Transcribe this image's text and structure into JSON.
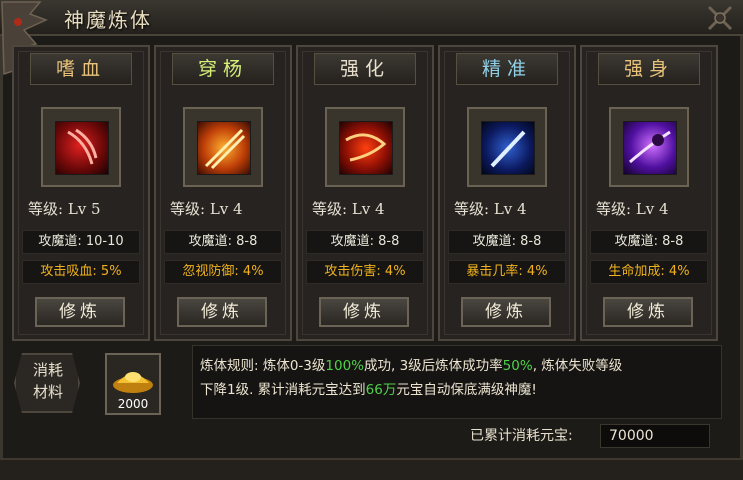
{
  "window": {
    "title": "神魔炼体"
  },
  "panels": [
    {
      "name": "嗜血",
      "name_color": "#e8c27a",
      "level": "等级: Lv 5",
      "stat": "攻魔道: 10-10",
      "bonus": "攻击吸血: 5%",
      "button": "修炼",
      "icon": "bleed-claw-icon"
    },
    {
      "name": "穿杨",
      "name_color": "#d6f07a",
      "level": "等级: Lv 4",
      "stat": "攻魔道: 8-8",
      "bonus": "忽视防御: 4%",
      "button": "修炼",
      "icon": "pierce-blade-icon"
    },
    {
      "name": "强化",
      "name_color": "#e8e0cc",
      "level": "等级: Lv 4",
      "stat": "攻魔道: 8-8",
      "bonus": "攻击伤害: 4%",
      "button": "修炼",
      "icon": "fire-whip-icon"
    },
    {
      "name": "精准",
      "name_color": "#8fd0e8",
      "level": "等级: Lv 4",
      "stat": "攻魔道: 8-8",
      "bonus": "暴击几率: 4%",
      "button": "修炼",
      "icon": "blue-sword-icon"
    },
    {
      "name": "强身",
      "name_color": "#e8c27a",
      "level": "等级: Lv 4",
      "stat": "攻魔道: 8-8",
      "bonus": "生命加成: 4%",
      "button": "修炼",
      "icon": "purple-strike-icon"
    }
  ],
  "consume": {
    "label_line1": "消耗",
    "label_line2": "材料",
    "item_icon": "gold-ingot-icon",
    "quantity": "2000"
  },
  "rules": {
    "l1_a": "炼体规则: 炼体0-3级",
    "l1_b": "100%",
    "l1_c": "成功, 3级后炼体成功率",
    "l1_d": "50%",
    "l1_e": ", 炼体失败等级",
    "l2_a": "下降1级. 累计消耗元宝达到",
    "l2_b": "66万",
    "l2_c": "元宝自动保底满级神魔!"
  },
  "total": {
    "label": "已累计消耗元宝:",
    "value": "70000"
  },
  "colors": {
    "highlight_green": "#4fd24a",
    "bonus_orange": "#f0b21e"
  }
}
